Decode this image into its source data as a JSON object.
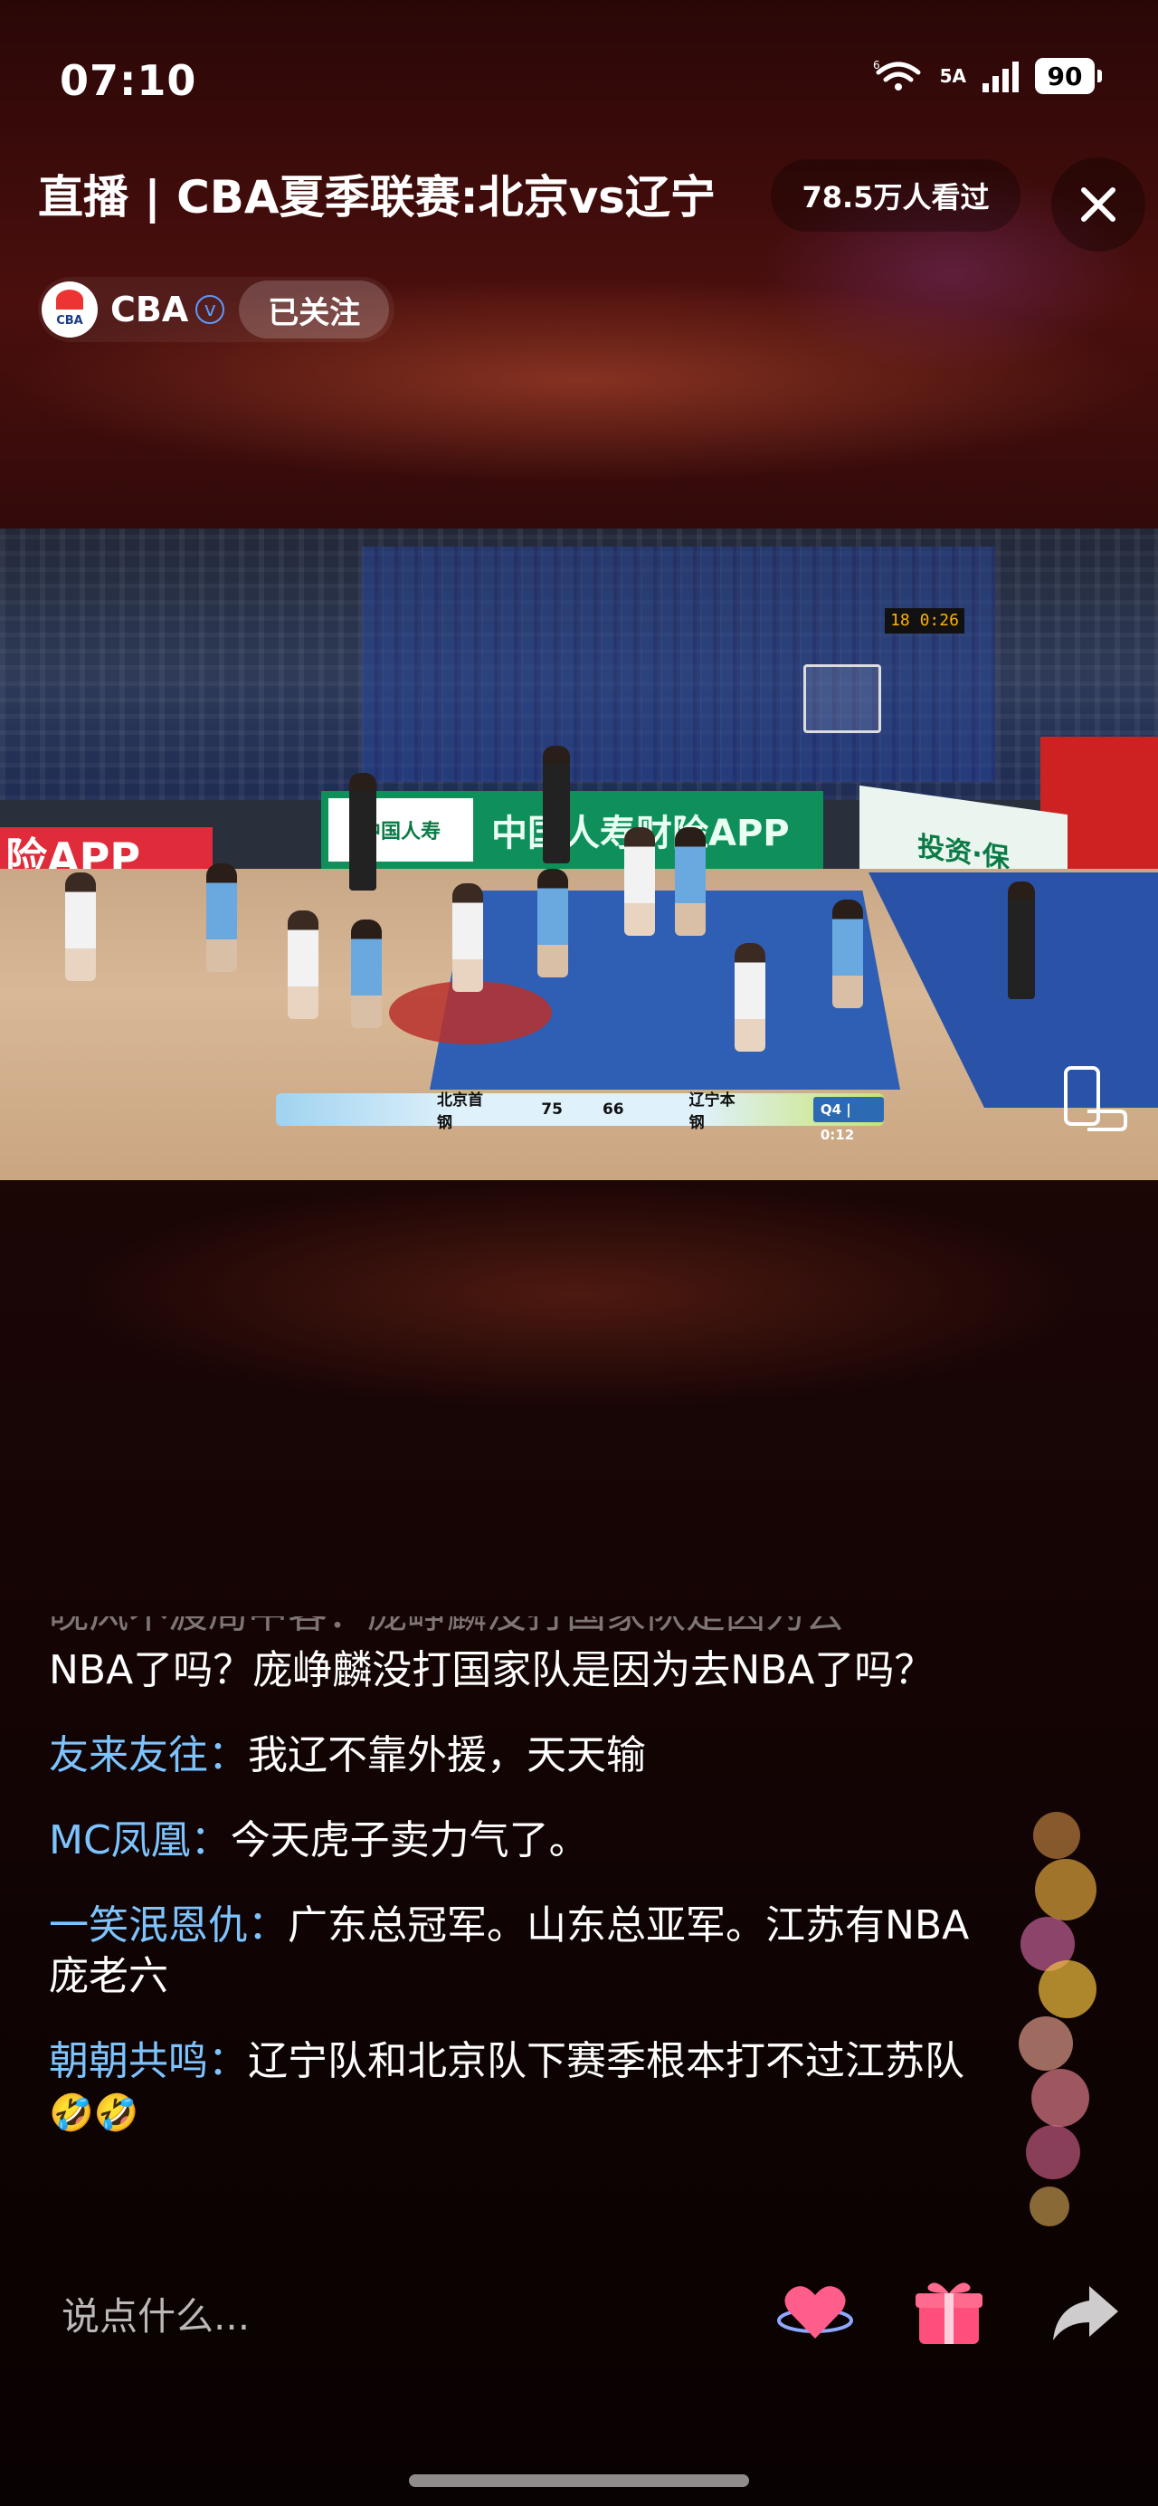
{
  "status_bar": {
    "time": "07:10",
    "wifi_label": "6",
    "signal_label": "5A",
    "battery": "90"
  },
  "header": {
    "title": "直播 | CBA夏季联赛:北京vs辽宁",
    "viewers": "78.5万人看过",
    "channel_name": "CBA",
    "verified_mark": "v",
    "follow_label": "已关注",
    "logo_text": "CBA"
  },
  "video": {
    "ad_left": "险APP",
    "ad_main_logo": "中国人寿",
    "ad_main": "中国人寿财险APP",
    "ad_right": "投资·保",
    "shot_clock": "18 0:26",
    "score": {
      "home_team": "北京首钢",
      "home_score": "75",
      "away_score": "66",
      "away_team": "辽宁本钢",
      "period": "Q4 | 0:12"
    }
  },
  "chat": {
    "partial": "晚风不渡局中客：庞峥麟没打国家队是因为去",
    "messages": [
      {
        "name": "",
        "text": "NBA了吗？庞峥麟没打国家队是因为去NBA了吗？"
      },
      {
        "name": "友来友往：",
        "text": "我辽不靠外援，天天输"
      },
      {
        "name": "MC凤凰：",
        "text": "今天虎子卖力气了。"
      },
      {
        "name": "一笑泯恩仇：",
        "text": "广东总冠军。山东总亚军。江苏有NBA庞老六"
      },
      {
        "name": "朝朝共鸣：",
        "text": "辽宁队和北京队下赛季根本打不过江苏队",
        "emoji": "🤣🤣"
      }
    ]
  },
  "input": {
    "placeholder": "说点什么..."
  },
  "icons": {
    "like": "heart-icon",
    "gift": "gift-icon",
    "share": "share-icon",
    "close": "close-icon",
    "rotate": "rotate-screen-icon"
  }
}
